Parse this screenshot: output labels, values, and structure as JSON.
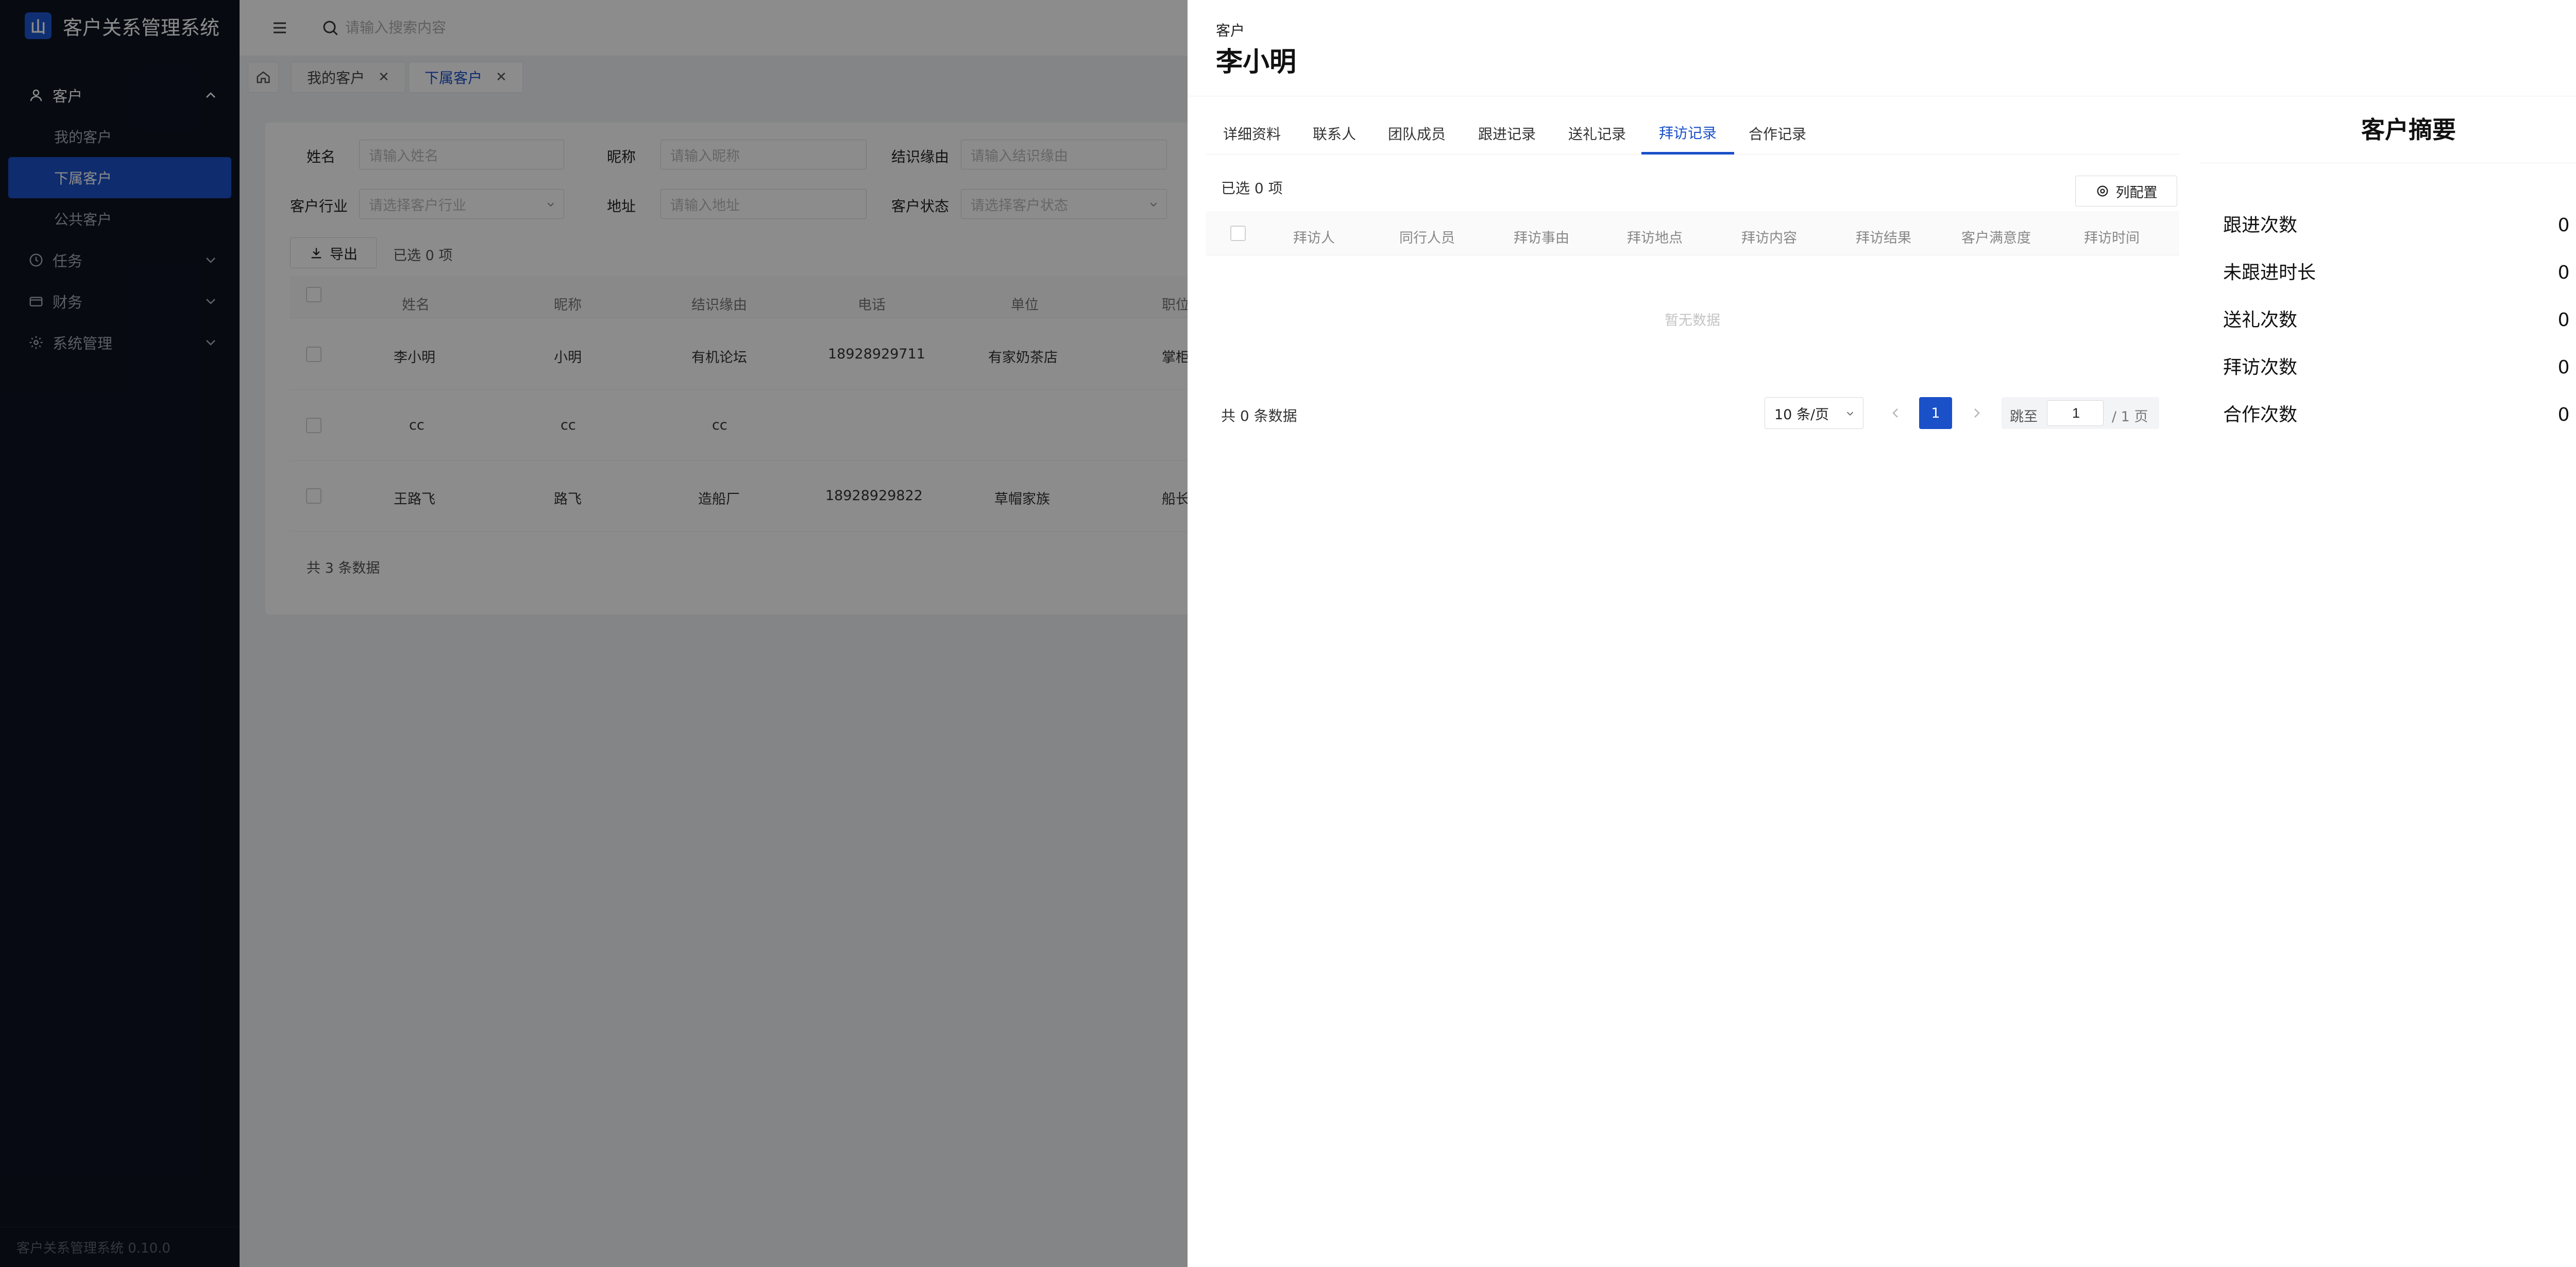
{
  "app": {
    "title": "客户关系管理系统",
    "logo_text": "山",
    "version_footer": "客户关系管理系统 0.10.0"
  },
  "sidebar": {
    "groups": [
      {
        "label": "客户",
        "icon": "user-icon",
        "expanded": true,
        "items": [
          {
            "label": "我的客户"
          },
          {
            "label": "下属客户",
            "active": true
          },
          {
            "label": "公共客户"
          }
        ]
      },
      {
        "label": "任务",
        "icon": "clock-icon"
      },
      {
        "label": "财务",
        "icon": "wallet-icon"
      },
      {
        "label": "系统管理",
        "icon": "gear-icon"
      }
    ]
  },
  "header": {
    "search_placeholder": "请输入搜索内容"
  },
  "tabs": [
    {
      "label": "我的客户"
    },
    {
      "label": "下属客户",
      "active": true
    }
  ],
  "filters": {
    "name_label": "姓名",
    "name_placeholder": "请输入姓名",
    "nickname_label": "昵称",
    "nickname_placeholder": "请输入昵称",
    "source_label": "结识缘由",
    "source_placeholder": "请输入结识缘由",
    "industry_label": "客户行业",
    "industry_placeholder": "请选择客户行业",
    "address_label": "地址",
    "address_placeholder": "请输入地址",
    "status_label": "客户状态",
    "status_placeholder": "请选择客户状态"
  },
  "list": {
    "export_label": "导出",
    "selected_text": "已选 0 项",
    "columns": [
      "姓名",
      "昵称",
      "结识缘由",
      "电话",
      "单位",
      "职位"
    ],
    "rows": [
      [
        "李小明",
        "小明",
        "有机论坛",
        "18928929711",
        "有家奶茶店",
        "掌柜"
      ],
      [
        "cc",
        "cc",
        "cc",
        "",
        "",
        ""
      ],
      [
        "王路飞",
        "路飞",
        "造船厂",
        "18928929822",
        "草帽家族",
        "船长"
      ]
    ],
    "total_text": "共 3 条数据"
  },
  "drawer": {
    "type_label": "客户",
    "customer_name": "李小明",
    "tabs": [
      {
        "label": "详细资料"
      },
      {
        "label": "联系人"
      },
      {
        "label": "团队成员"
      },
      {
        "label": "跟进记录"
      },
      {
        "label": "送礼记录"
      },
      {
        "label": "拜访记录",
        "active": true
      },
      {
        "label": "合作记录"
      }
    ],
    "selected_text": "已选 0 项",
    "column_config_label": "列配置",
    "columns": [
      "拜访人",
      "同行人员",
      "拜访事由",
      "拜访地点",
      "拜访内容",
      "拜访结果",
      "客户满意度",
      "拜访时间"
    ],
    "empty_text": "暂无数据",
    "total_text": "共 0 条数据",
    "pagination": {
      "page_size": "10 条/页",
      "current_page": "1",
      "jump_label": "跳至",
      "jump_value": "1",
      "total_pages": "/ 1 页"
    },
    "summary": {
      "title": "客户摘要",
      "rows": [
        {
          "label": "跟进次数",
          "value": "0 次"
        },
        {
          "label": "未跟进时长",
          "value": "0 天"
        },
        {
          "label": "送礼次数",
          "value": "0 次"
        },
        {
          "label": "拜访次数",
          "value": "0 次"
        },
        {
          "label": "合作次数",
          "value": "0 次"
        }
      ]
    }
  },
  "colors": {
    "primary": "#1a50c8",
    "sidebar_bg": "#0d1320",
    "overlay": "rgba(0,0,0,0.45)"
  }
}
